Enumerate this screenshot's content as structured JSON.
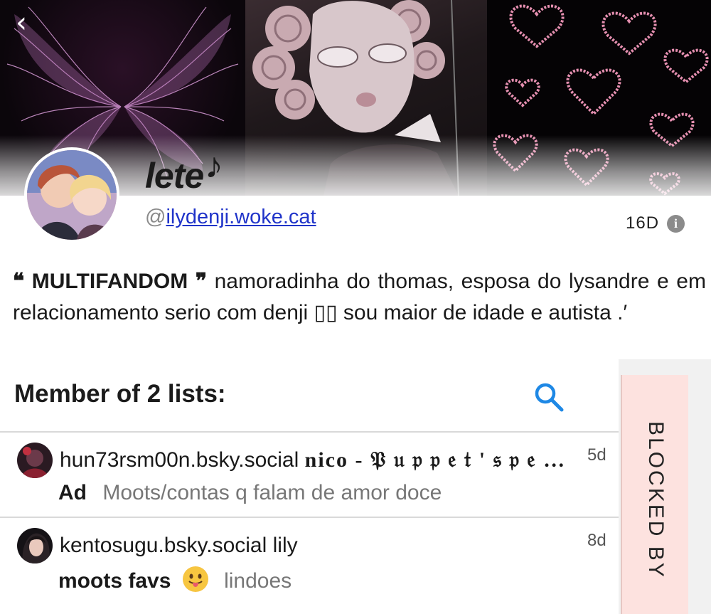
{
  "nav": {
    "back_glyph": "‹"
  },
  "profile": {
    "display_name": "lete",
    "display_name_suffix": "𝅘𝅥𝅮",
    "handle_at": "@",
    "handle": "ilydenji.woke.cat",
    "age": "16D",
    "info_glyph": "i"
  },
  "bio": {
    "open_quote": "❝",
    "fandom": "MULTIFANDOM",
    "close_quote": "❞",
    "text": "namoradinha do thomas, esposa do lysandre e em relacionamento serio com denji ▯▯ sou maior de idade e autista .′"
  },
  "lists": {
    "title": "Member of 2 lists:",
    "items": [
      {
        "handle": "hun73rsm00n.bsky.social",
        "owner_name": "nico - 𝔓 𝔲 𝔭 𝔭 𝔢 𝔱 ' 𝔰 𝔭 𝔢 …",
        "date": "5d",
        "list_name": "Ad",
        "description": "Moots/contas q falam de amor doce"
      },
      {
        "handle": "kentosugu.bsky.social",
        "owner_name": "lily",
        "date": "8d",
        "list_name": "moots favs",
        "emoji": "😛",
        "description": "lindoes"
      }
    ]
  },
  "side_tab": {
    "label": "BLOCKED BY"
  },
  "colors": {
    "link": "#1f33c9",
    "search_icon": "#1e88e5",
    "blocked_tab_bg": "#fde2df",
    "info_icon": "#8b8b8b"
  }
}
